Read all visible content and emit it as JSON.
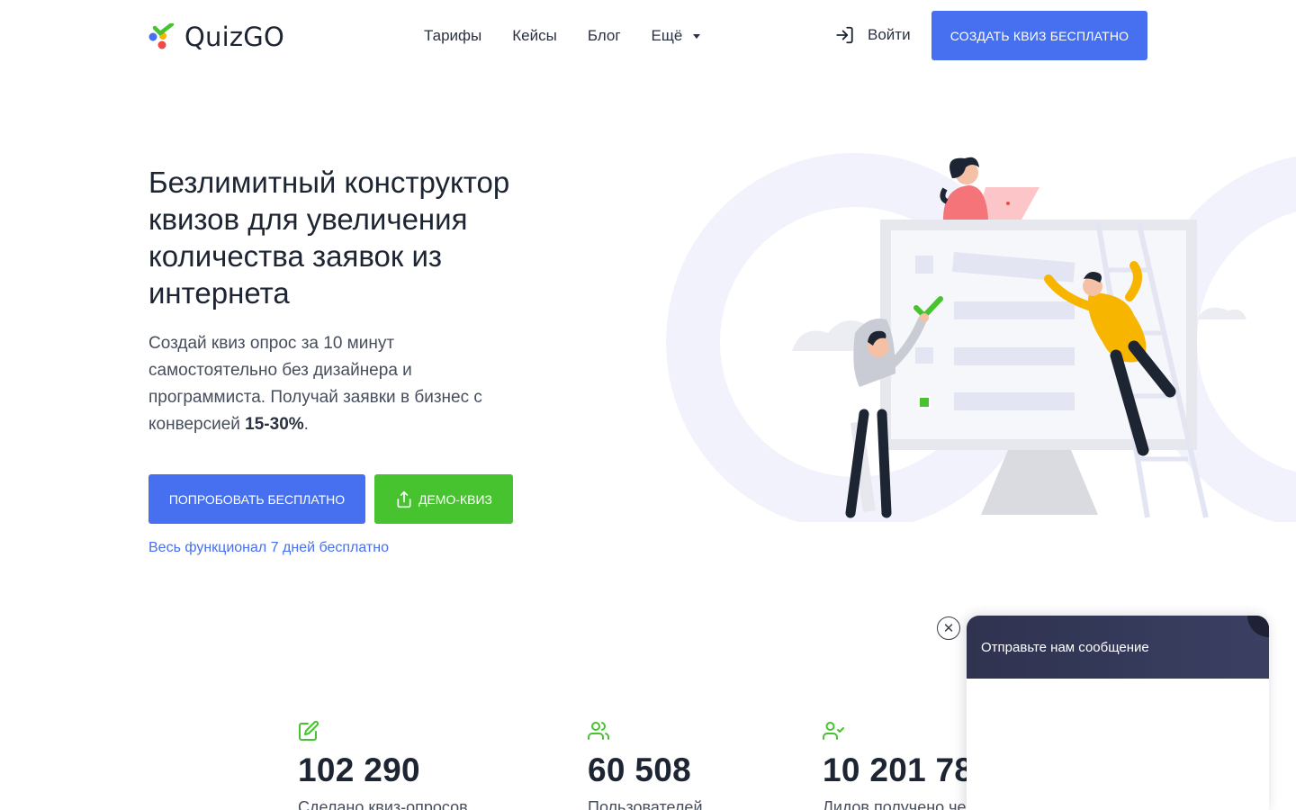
{
  "brand": {
    "name": "QuizGO",
    "colors": {
      "primary": "#4670ef",
      "green": "#46c32f",
      "dark": "#1d2533"
    }
  },
  "nav": {
    "items": [
      {
        "label": "Тарифы"
      },
      {
        "label": "Кейсы"
      },
      {
        "label": "Блог"
      },
      {
        "label": "Ещё"
      }
    ],
    "login_label": "Войти",
    "login_icon": "sign-in-icon",
    "cta_label": "СОЗДАТЬ КВИЗ БЕСПЛАТНО"
  },
  "hero": {
    "title": "Безлимитный конструктор квизов для увеличения количества заявок из интернета",
    "subtitle_pre": "Создай квиз опрос за 10 минут самостоятельно без дизайнера и программиста. Получай заявки в бизнес с конверсией ",
    "subtitle_bold": "15-30%",
    "subtitle_post": ".",
    "btn_try": "ПОПРОБОВАТЬ БЕСПЛАТНО",
    "btn_demo": "ДЕМО-КВИЗ",
    "btn_demo_icon": "share-upload-icon",
    "trial_note": "Весь функционал 7 дней бесплатно"
  },
  "stats": [
    {
      "icon": "edit-icon",
      "value": "102 290",
      "label": "Сделано квиз-опросов"
    },
    {
      "icon": "users-icon",
      "value": "60 508",
      "label": "Пользователей"
    },
    {
      "icon": "user-check-icon",
      "value": "10 201 78",
      "label": "Лидов получено че"
    }
  ],
  "chat": {
    "header": "Отправьте нам сообщение",
    "close_symbol": "✕"
  }
}
